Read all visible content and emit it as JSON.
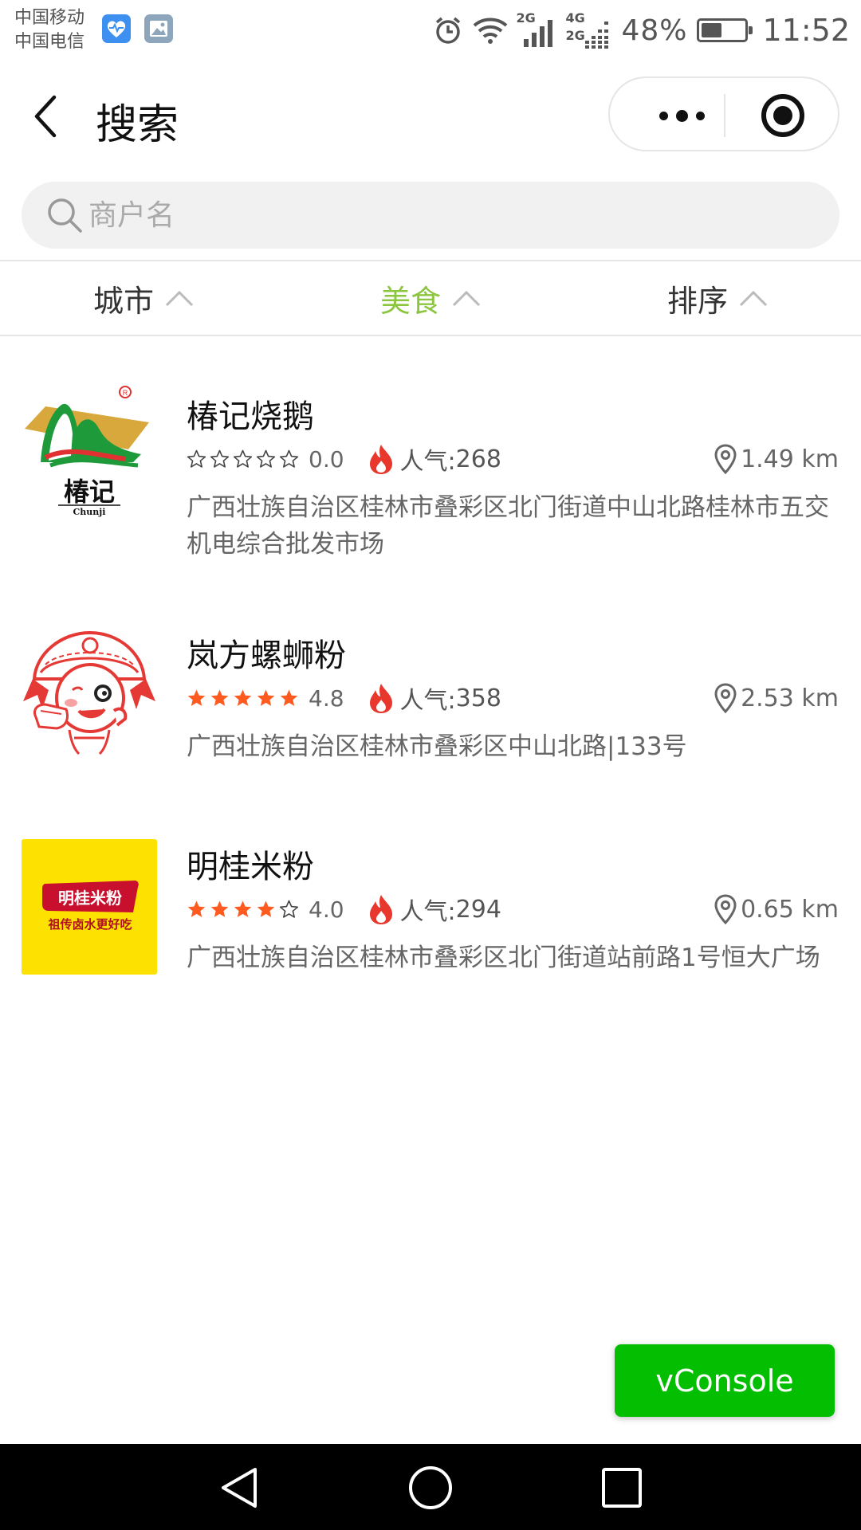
{
  "status_bar": {
    "carrier1": "中国移动",
    "carrier2": "中国电信",
    "network1": "2G",
    "network2_top": "4G",
    "network2_bottom": "2G",
    "battery_percent": "48%",
    "battery_level": 0.48,
    "time": "11:52",
    "icons": [
      "health-app-icon",
      "gallery-app-icon",
      "alarm-icon",
      "wifi-icon",
      "signal-icon",
      "battery-icon"
    ]
  },
  "navbar": {
    "title": "搜索"
  },
  "search": {
    "placeholder": "商户名",
    "value": ""
  },
  "filters": [
    {
      "label": "城市",
      "active": false
    },
    {
      "label": "美食",
      "active": true
    },
    {
      "label": "排序",
      "active": false
    }
  ],
  "colors": {
    "accent_green": "#8cc63f",
    "star_orange": "#ff5a1f",
    "fire_red": "#e8372c",
    "vconsole_green": "#04be02"
  },
  "merchants": [
    {
      "name": "椿记烧鹅",
      "rating": 0.0,
      "rating_text": "0.0",
      "popularity_label": "人气:",
      "popularity": "268",
      "distance": "1.49 km",
      "address": "广西壮族自治区桂林市叠彩区北门街道中山北路桂林市五交机电综合批发市场",
      "logo": "chunji-logo",
      "logo_text": "椿记",
      "logo_subtext": "Chunji"
    },
    {
      "name": "岚方螺蛳粉",
      "rating": 4.8,
      "rating_text": "4.8",
      "popularity_label": "人气:",
      "popularity": "358",
      "distance": "2.53 km",
      "address": "广西壮族自治区桂林市叠彩区中山北路|133号",
      "logo": "lanfang-logo"
    },
    {
      "name": "明桂米粉",
      "rating": 4.0,
      "rating_text": "4.0",
      "popularity_label": "人气:",
      "popularity": "294",
      "distance": "0.65 km",
      "address": "广西壮族自治区桂林市叠彩区北门街道站前路1号恒大广场",
      "logo": "minggui-logo",
      "logo_text": "明桂米粉",
      "logo_subtext": "祖传卤水更好吃"
    }
  ],
  "vconsole": {
    "label": "vConsole"
  },
  "system_nav": {
    "icons": [
      "nav-back-icon",
      "nav-home-icon",
      "nav-recents-icon"
    ]
  }
}
